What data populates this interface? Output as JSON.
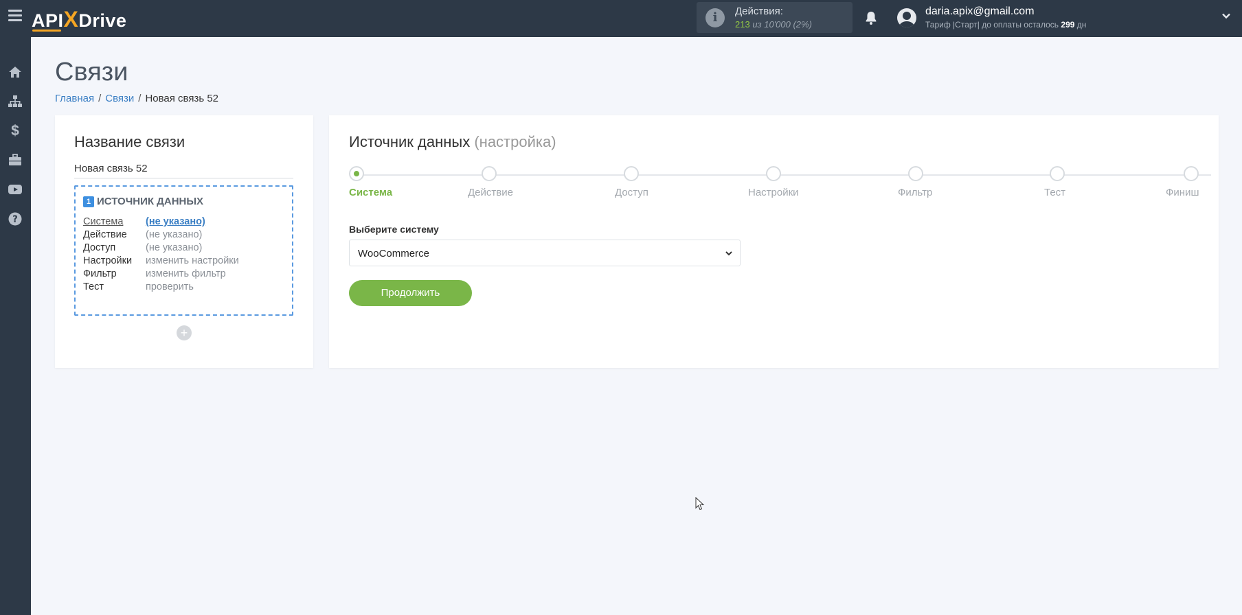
{
  "topbar": {
    "logo_api": "API",
    "logo_x": "X",
    "logo_drive": "Drive",
    "actions_title": "Действия:",
    "actions_used": "213",
    "actions_of": "из 10'000 (2%)",
    "user_email": "daria.apix@gmail.com",
    "user_plan_prefix": "Тариф |Старт| до оплаты осталось",
    "user_plan_days": "299",
    "user_plan_suffix": "дн",
    "icons": [
      "menu-icon",
      "info-icon",
      "bell-icon",
      "user-avatar-icon",
      "chevron-down-icon"
    ]
  },
  "sidebar": {
    "items": [
      {
        "icon": "home-icon"
      },
      {
        "icon": "sitemap-icon"
      },
      {
        "icon": "dollar-icon"
      },
      {
        "icon": "briefcase-icon"
      },
      {
        "icon": "youtube-icon"
      },
      {
        "icon": "question-icon"
      }
    ]
  },
  "page": {
    "title": "Связи",
    "breadcrumb": [
      "Главная",
      "Связи",
      "Новая связь 52"
    ]
  },
  "connection": {
    "title": "Название связи",
    "name_value": "Новая связь 52",
    "source_number": "1",
    "source_title": "ИСТОЧНИК ДАННЫХ",
    "rows": [
      {
        "label": "Система",
        "value": "(не указано)"
      },
      {
        "label": "Действие",
        "value": "(не указано)"
      },
      {
        "label": "Доступ",
        "value": "(не указано)"
      },
      {
        "label": "Настройки",
        "value": "изменить настройки"
      },
      {
        "label": "Фильтр",
        "value": "изменить фильтр"
      },
      {
        "label": "Тест",
        "value": "проверить"
      }
    ],
    "add_label": "+"
  },
  "setup": {
    "title": "Источник данных",
    "subtitle": "(настройка)",
    "steps": [
      "Система",
      "Действие",
      "Доступ",
      "Настройки",
      "Фильтр",
      "Тест",
      "Финиш"
    ],
    "active_step": 0,
    "field_label": "Выберите систему",
    "selected_system": "WooCommerce",
    "continue_label": "Продолжить"
  },
  "colors": {
    "topbar": "#2d3947",
    "accent_green": "#7ab648",
    "link_blue": "#3b7fc4",
    "logo_orange": "#f5a623"
  }
}
